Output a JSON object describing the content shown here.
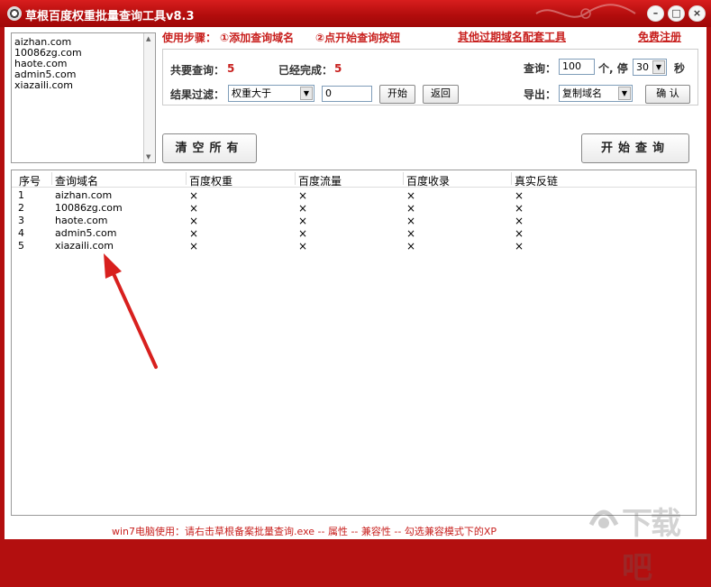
{
  "window": {
    "title": "草根百度权重批量查询工具v8.3"
  },
  "title_buttons": [
    "–",
    "□",
    "×"
  ],
  "domain_list": [
    "aizhan.com",
    "10086zg.com",
    "haote.com",
    "admin5.com",
    "xiazaili.com"
  ],
  "steps": {
    "label": "使用步骤：",
    "step1": "①添加查询域名",
    "step2": "②点开始查询按钮"
  },
  "links": {
    "tools": "其他过期域名配套工具",
    "register": "免费注册"
  },
  "stats": {
    "total_label": "共要查询：",
    "total_value": "5",
    "done_label": "已经完成：",
    "done_value": "5"
  },
  "filter": {
    "label": "结果过滤：",
    "select_value": "权重大于",
    "input_value": "0",
    "start_label": "开始",
    "back_label": "返回"
  },
  "query": {
    "label": "查询：",
    "count_value": "100",
    "unit_text": "个, 停",
    "stop_value": "30",
    "sec_text": "秒"
  },
  "export": {
    "label": "导出：",
    "select_value": "复制域名",
    "confirm_label": "确 认"
  },
  "buttons": {
    "clear_all": "清空所有",
    "start_query": "开始查询"
  },
  "table": {
    "columns": [
      "序号",
      "查询域名",
      "百度权重",
      "百度流量",
      "百度收录",
      "真实反链"
    ],
    "rows": [
      [
        "1",
        "aizhan.com",
        "×",
        "×",
        "×",
        "×"
      ],
      [
        "2",
        "10086zg.com",
        "×",
        "×",
        "×",
        "×"
      ],
      [
        "3",
        "haote.com",
        "×",
        "×",
        "×",
        "×"
      ],
      [
        "4",
        "admin5.com",
        "×",
        "×",
        "×",
        "×"
      ],
      [
        "5",
        "xiazaili.com",
        "×",
        "×",
        "×",
        "×"
      ]
    ]
  },
  "footer_note": "win7电脑使用：请右击草根备案批量查询.exe -- 属性 -- 兼容性 -- 勾选兼容模式下的XP",
  "watermark_text": "下载吧",
  "colors": {
    "title_bar": "#b30f0f",
    "accent_red": "#c8201e"
  },
  "icons": [
    "app-icon",
    "minimize-icon",
    "maximize-icon",
    "close-icon",
    "scroll-up-icon",
    "scroll-down-icon",
    "dropdown-arrow-icon",
    "red-arrow-annotation"
  ]
}
